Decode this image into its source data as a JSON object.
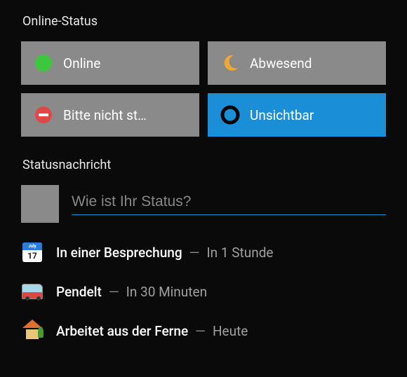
{
  "online_status": {
    "title": "Online-Status",
    "options": [
      {
        "id": "online",
        "label": "Online",
        "icon": "online-dot-icon",
        "color": "#3cc83c"
      },
      {
        "id": "away",
        "label": "Abwesend",
        "icon": "moon-icon",
        "color": "#f0a830"
      },
      {
        "id": "dnd",
        "label": "Bitte nicht st…",
        "icon": "dnd-icon",
        "color": "#e04848"
      },
      {
        "id": "invisible",
        "label": "Unsichtbar",
        "icon": "circle-outline-icon",
        "color": "#000000",
        "selected": true
      }
    ]
  },
  "status_message": {
    "title": "Statusnachricht",
    "placeholder": "Wie ist Ihr Status?",
    "value": ""
  },
  "suggestions": [
    {
      "emoji_name": "calendar-icon",
      "label": "In einer Besprechung",
      "duration": "In 1 Stunde"
    },
    {
      "emoji_name": "bus-icon",
      "label": "Pendelt",
      "duration": "In 30 Minuten"
    },
    {
      "emoji_name": "house-icon",
      "label": "Arbeitet aus der Ferne",
      "duration": "Heute"
    }
  ],
  "colors": {
    "selected_bg": "#1a8fd8",
    "card_bg": "#8a8a8a"
  }
}
